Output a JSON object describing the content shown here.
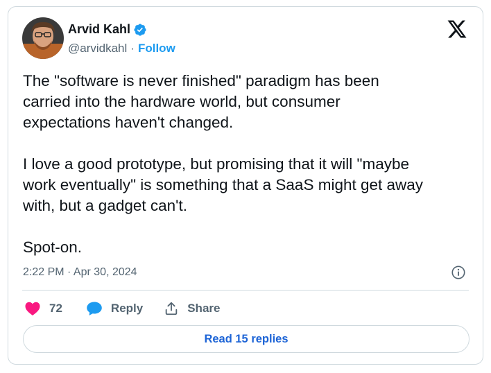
{
  "author": {
    "name": "Arvid Kahl",
    "handle": "@arvidkahl",
    "separator": "·",
    "follow_label": "Follow",
    "verified_icon": "verified-badge-icon"
  },
  "tweet": {
    "text": "The \"software is never finished\" paradigm has been\ncarried into the hardware world, but consumer\nexpectations haven't changed.\n\nI love a good prototype, but promising that it will \"maybe\nwork eventually\" is something that a SaaS might get away\nwith, but a gadget can't.\n\nSpot-on.",
    "timestamp": "2:22 PM · Apr 30, 2024"
  },
  "actions": {
    "like_count": "72",
    "reply_label": "Reply",
    "share_label": "Share"
  },
  "read_replies_label": "Read 15 replies",
  "icons": {
    "brand": "x-logo-icon",
    "info": "info-icon",
    "like": "heart-icon",
    "reply": "speech-bubble-icon",
    "share": "share-upload-icon"
  },
  "colors": {
    "accent": "#1d9bf0",
    "like": "#f91880",
    "text": "#0f1419",
    "muted": "#536471",
    "border": "#cfd9de"
  }
}
